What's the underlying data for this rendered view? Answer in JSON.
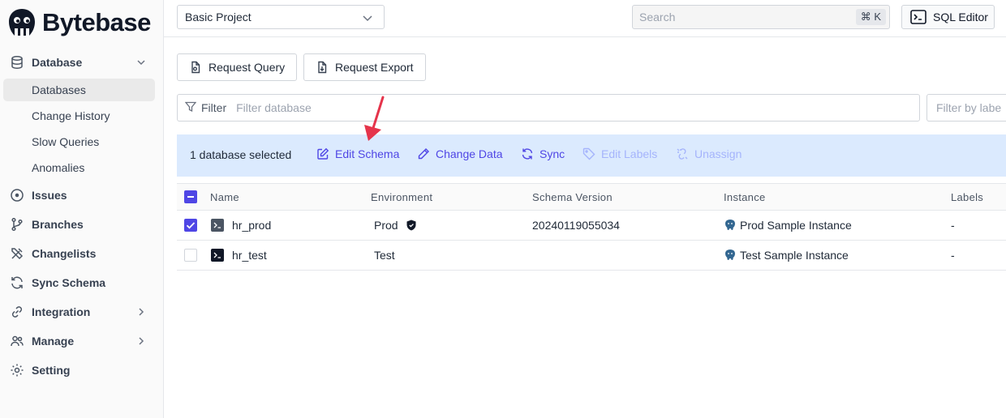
{
  "app": {
    "brand": "Bytebase"
  },
  "sidebar": {
    "database": {
      "label": "Database",
      "subitems": [
        "Databases",
        "Change History",
        "Slow Queries",
        "Anomalies"
      ]
    },
    "items": [
      {
        "label": "Issues"
      },
      {
        "label": "Branches"
      },
      {
        "label": "Changelists"
      },
      {
        "label": "Sync Schema"
      },
      {
        "label": "Integration"
      },
      {
        "label": "Manage"
      },
      {
        "label": "Setting"
      }
    ]
  },
  "topbar": {
    "project": "Basic Project",
    "search_placeholder": "Search",
    "search_shortcut": "⌘ K",
    "sql_editor": "SQL Editor"
  },
  "toolbar": {
    "request_query": "Request Query",
    "request_export": "Request Export"
  },
  "filter": {
    "label": "Filter",
    "placeholder": "Filter database",
    "labels_placeholder": "Filter by labe"
  },
  "actions": {
    "selected": "1 database selected",
    "edit_schema": "Edit Schema",
    "change_data": "Change Data",
    "sync": "Sync",
    "edit_labels": "Edit Labels",
    "unassign": "Unassign"
  },
  "table": {
    "headers": [
      "Name",
      "Environment",
      "Schema Version",
      "Instance",
      "Labels"
    ],
    "rows": [
      {
        "name": "hr_prod",
        "environment": "Prod",
        "schema_version": "20240119055034",
        "instance": "Prod Sample Instance",
        "labels": "-",
        "selected": true
      },
      {
        "name": "hr_test",
        "environment": "Test",
        "schema_version": "",
        "instance": "Test Sample Instance",
        "labels": "-",
        "selected": false
      }
    ]
  },
  "colors": {
    "accent": "#4f46e5",
    "selection_bar": "#dbeafe",
    "annotation_arrow": "#e5344b"
  }
}
